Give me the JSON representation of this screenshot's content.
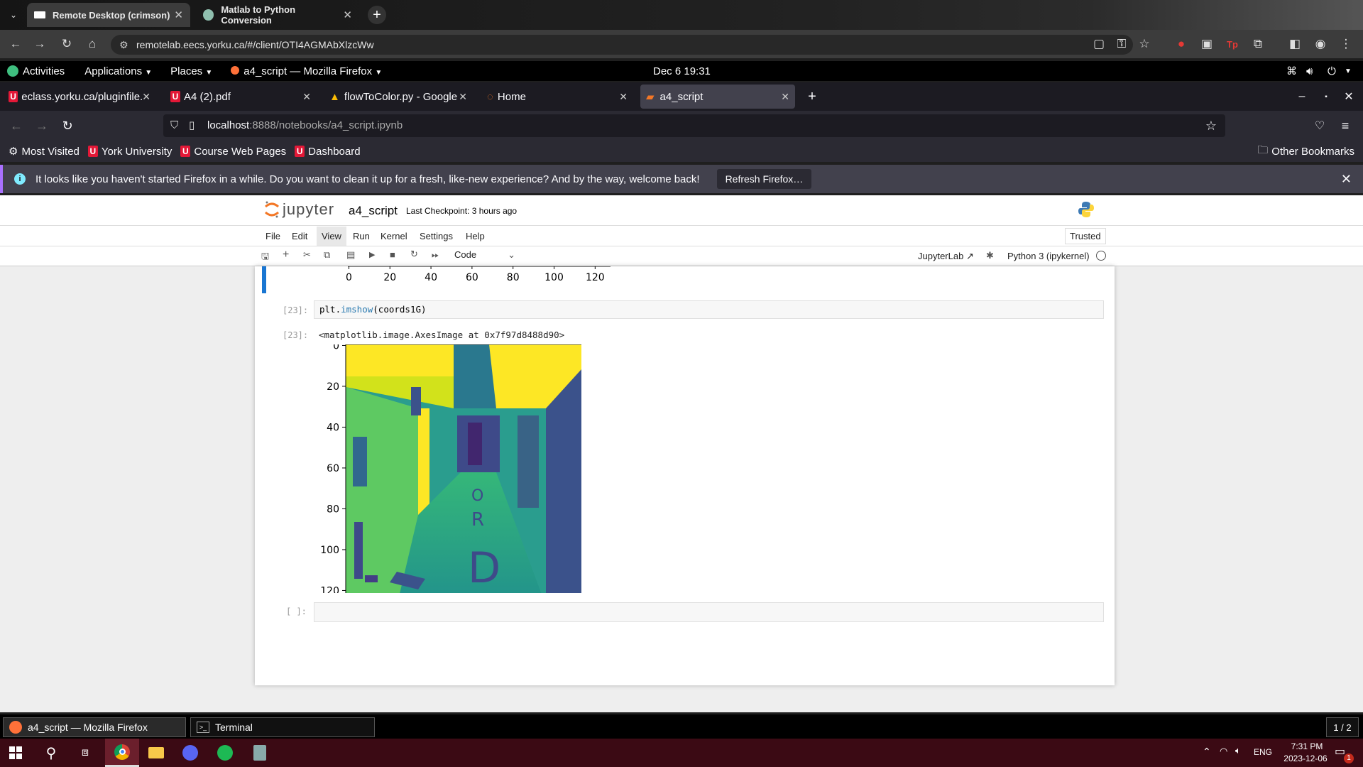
{
  "chrome": {
    "tabs": [
      {
        "label": "Remote Desktop (crimson)",
        "icon": "remote-desktop-icon"
      },
      {
        "label": "Matlab to Python Conversion",
        "icon": "chatgpt-icon"
      }
    ],
    "url": "remotelab.eecs.yorku.ca/#/client/OTI4AGMAbXlzcWw"
  },
  "gnome": {
    "activities": "Activities",
    "applications": "Applications",
    "places": "Places",
    "window_title": "a4_script — Mozilla Firefox",
    "clock": "Dec 6  19:31"
  },
  "firefox": {
    "tabs": [
      {
        "label": "eclass.yorku.ca/pluginfile.p"
      },
      {
        "label": "A4 (2).pdf"
      },
      {
        "label": "flowToColor.py - Google D"
      },
      {
        "label": "Home"
      },
      {
        "label": "a4_script"
      }
    ],
    "url_host": "localhost",
    "url_path": ":8888/notebooks/a4_script.ipynb",
    "bookmarks": [
      "Most Visited",
      "York University",
      "Course Web Pages",
      "Dashboard"
    ],
    "other_bookmarks": "Other Bookmarks",
    "notice": "It looks like you haven't started Firefox in a while. Do you want to clean it up for a fresh, like-new experience? And by the way, welcome back!",
    "refresh_button": "Refresh Firefox…"
  },
  "jupyter": {
    "logo": "jupyter",
    "notebook_name": "a4_script",
    "checkpoint": "Last Checkpoint: 3 hours ago",
    "menu": [
      "File",
      "Edit",
      "View",
      "Run",
      "Kernel",
      "Settings",
      "Help"
    ],
    "trusted": "Trusted",
    "cell_type": "Code",
    "jupyterlab_link": "JupyterLab",
    "kernel": "Python 3 (ipykernel)",
    "prev_xticks": [
      "0",
      "20",
      "40",
      "60",
      "80",
      "100",
      "120"
    ],
    "cell_in_prompt": "[23]:",
    "cell_code_obj": "plt.",
    "cell_code_fn": "imshow",
    "cell_code_args": "(coords1G)",
    "cell_out_prompt": "[23]:",
    "cell_output": "<matplotlib.image.AxesImage at 0x7f97d8488d90>",
    "empty_prompt": "[ ]:"
  },
  "chart_data": {
    "type": "heatmap",
    "title": "",
    "xlabel": "",
    "ylabel": "",
    "x_ticks": [
      0,
      20,
      40,
      60,
      80,
      100,
      120
    ],
    "y_ticks": [
      0,
      20,
      40,
      60,
      80,
      100,
      120
    ],
    "xlim": [
      0,
      127
    ],
    "ylim": [
      127,
      0
    ],
    "colormap": "viridis",
    "description": "grayscale image of a hallway rendered with viridis colormap"
  },
  "taskbar": {
    "windows": [
      "a4_script — Mozilla Firefox",
      "Terminal"
    ],
    "workspace": "1 / 2",
    "lang": "ENG",
    "time": "7:31 PM",
    "date": "2023-12-06",
    "notifications": "1"
  }
}
